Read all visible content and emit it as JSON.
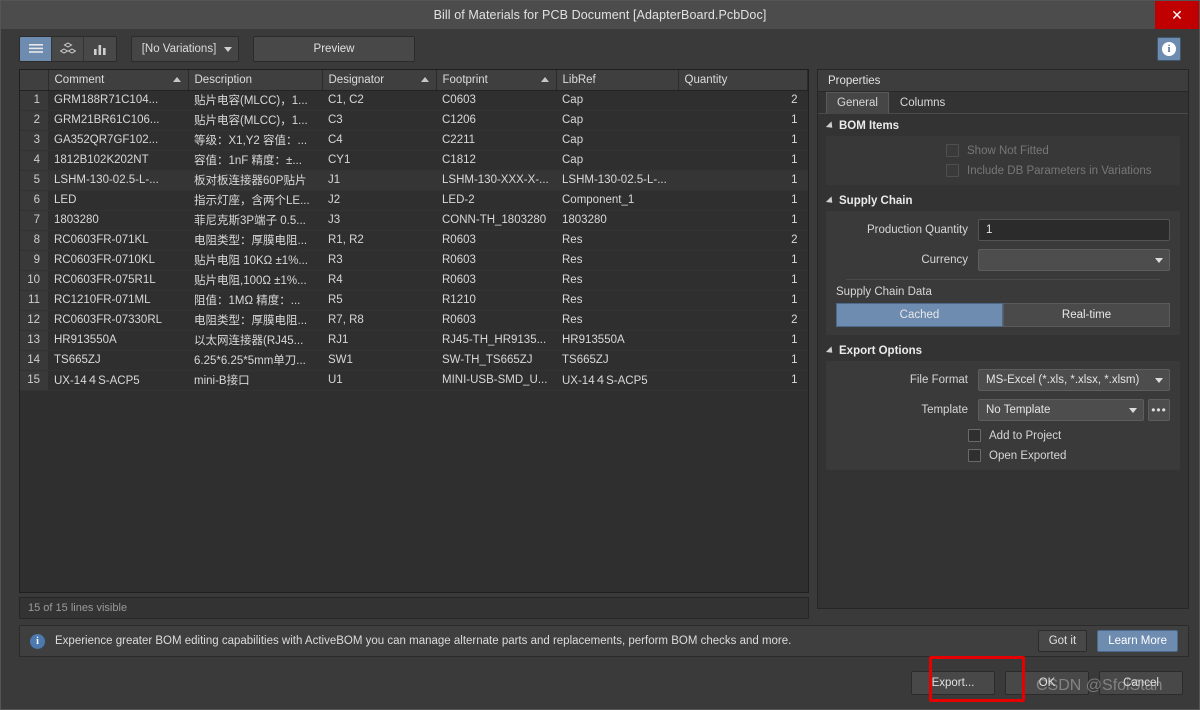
{
  "window": {
    "title": "Bill of Materials for PCB Document [AdapterBoard.PcbDoc]",
    "close_glyph": "✕"
  },
  "toolbar": {
    "view_icons": [
      {
        "name": "list-view-icon",
        "glyph": "≡",
        "active": true
      },
      {
        "name": "grouped-view-icon",
        "glyph": "⛁",
        "active": false
      },
      {
        "name": "chart-view-icon",
        "glyph": "▮▮",
        "active": false
      }
    ],
    "variations_value": "[No Variations]",
    "preview_label": "Preview",
    "info_glyph": "i"
  },
  "table": {
    "columns": [
      {
        "key": "idx",
        "label": "",
        "sorted": false
      },
      {
        "key": "comment",
        "label": "Comment",
        "sorted": true
      },
      {
        "key": "description",
        "label": "Description",
        "sorted": false
      },
      {
        "key": "designator",
        "label": "Designator",
        "sorted": true
      },
      {
        "key": "footprint",
        "label": "Footprint",
        "sorted": true
      },
      {
        "key": "libref",
        "label": "LibRef",
        "sorted": false
      },
      {
        "key": "quantity",
        "label": "Quantity",
        "sorted": false
      }
    ],
    "rows": [
      {
        "idx": "1",
        "comment": "GRM188R71C104...",
        "description": "贴片电容(MLCC)，1...",
        "designator": "C1, C2",
        "footprint": "C0603",
        "libref": "Cap",
        "quantity": "2"
      },
      {
        "idx": "2",
        "comment": "GRM21BR61C106...",
        "description": "贴片电容(MLCC)，1...",
        "designator": "C3",
        "footprint": "C1206",
        "libref": "Cap",
        "quantity": "1"
      },
      {
        "idx": "3",
        "comment": "GA352QR7GF102...",
        "description": "等级：X1,Y2 容值：...",
        "designator": "C4",
        "footprint": "C2211",
        "libref": "Cap",
        "quantity": "1"
      },
      {
        "idx": "4",
        "comment": "1812B102K202NT",
        "description": "容值：1nF 精度：±...",
        "designator": "CY1",
        "footprint": "C1812",
        "libref": "Cap",
        "quantity": "1"
      },
      {
        "idx": "5",
        "comment": "LSHM-130-02.5-L-...",
        "description": "板对板连接器60P贴片",
        "designator": "J1",
        "footprint": "LSHM-130-XXX-X-...",
        "libref": "LSHM-130-02.5-L-...",
        "quantity": "1"
      },
      {
        "idx": "6",
        "comment": "LED",
        "description": "指示灯座，含两个LE...",
        "designator": "J2",
        "footprint": "LED-2",
        "libref": "Component_1",
        "quantity": "1"
      },
      {
        "idx": "7",
        "comment": "1803280",
        "description": "菲尼克斯3P端子 0.5...",
        "designator": "J3",
        "footprint": "CONN-TH_1803280",
        "libref": "1803280",
        "quantity": "1"
      },
      {
        "idx": "8",
        "comment": "RC0603FR-071KL",
        "description": "电阻类型：厚膜电阻...",
        "designator": "R1, R2",
        "footprint": "R0603",
        "libref": "Res",
        "quantity": "2"
      },
      {
        "idx": "9",
        "comment": "RC0603FR-0710KL",
        "description": "贴片电阻 10KΩ ±1%...",
        "designator": "R3",
        "footprint": "R0603",
        "libref": "Res",
        "quantity": "1"
      },
      {
        "idx": "10",
        "comment": "RC0603FR-075R1L",
        "description": "贴片电阻,100Ω ±1%...",
        "designator": "R4",
        "footprint": "R0603",
        "libref": "Res",
        "quantity": "1"
      },
      {
        "idx": "11",
        "comment": "RC1210FR-071ML",
        "description": "阻值：1MΩ 精度：...",
        "designator": "R5",
        "footprint": "R1210",
        "libref": "Res",
        "quantity": "1"
      },
      {
        "idx": "12",
        "comment": "RC0603FR-07330RL",
        "description": "电阻类型：厚膜电阻...",
        "designator": "R7, R8",
        "footprint": "R0603",
        "libref": "Res",
        "quantity": "2"
      },
      {
        "idx": "13",
        "comment": "HR913550A",
        "description": "以太网连接器(RJ45...",
        "designator": "RJ1",
        "footprint": "RJ45-TH_HR9135...",
        "libref": "HR913550A",
        "quantity": "1"
      },
      {
        "idx": "14",
        "comment": "TS665ZJ",
        "description": "6.25*6.25*5mm单刀...",
        "designator": "SW1",
        "footprint": "SW-TH_TS665ZJ",
        "libref": "TS665ZJ",
        "quantity": "1"
      },
      {
        "idx": "15",
        "comment": "UX-14４S-ACP5",
        "description": "mini-B接口",
        "designator": "U1",
        "footprint": "MINI-USB-SMD_U...",
        "libref": "UX-14４S-ACP5",
        "quantity": "1"
      }
    ],
    "status": "15 of 15 lines visible"
  },
  "properties": {
    "title": "Properties",
    "tabs": [
      {
        "label": "General",
        "active": true
      },
      {
        "label": "Columns",
        "active": false
      }
    ],
    "bom_items": {
      "section_label": "BOM Items",
      "show_not_fitted": "Show Not Fitted",
      "include_db_params": "Include DB Parameters in Variations"
    },
    "supply_chain": {
      "section_label": "Supply Chain",
      "production_quantity_label": "Production Quantity",
      "production_quantity_value": "1",
      "currency_label": "Currency",
      "currency_value": "",
      "supply_chain_data_label": "Supply Chain Data",
      "cached_label": "Cached",
      "realtime_label": "Real-time"
    },
    "export_options": {
      "section_label": "Export Options",
      "file_format_label": "File Format",
      "file_format_value": "MS-Excel (*.xls, *.xlsx, *.xlsm)",
      "template_label": "Template",
      "template_value": "No Template",
      "template_browse_glyph": "•••",
      "add_to_project": "Add to Project",
      "open_exported": "Open Exported"
    }
  },
  "notification": {
    "icon_glyph": "i",
    "text": "Experience greater BOM editing capabilities with ActiveBOM you can manage alternate parts and replacements, perform BOM checks and more.",
    "got_it_label": "Got it",
    "learn_more_label": "Learn More"
  },
  "footer": {
    "export_label": "Export...",
    "ok_label": "OK",
    "cancel_label": "Cancel"
  },
  "watermark": "CSDN @SfoiStan",
  "colors": {
    "accent_blue": "#6d8cb0",
    "close_red": "#c00000",
    "highlight_red": "#e60000",
    "window_bg": "#3a3a3a"
  }
}
